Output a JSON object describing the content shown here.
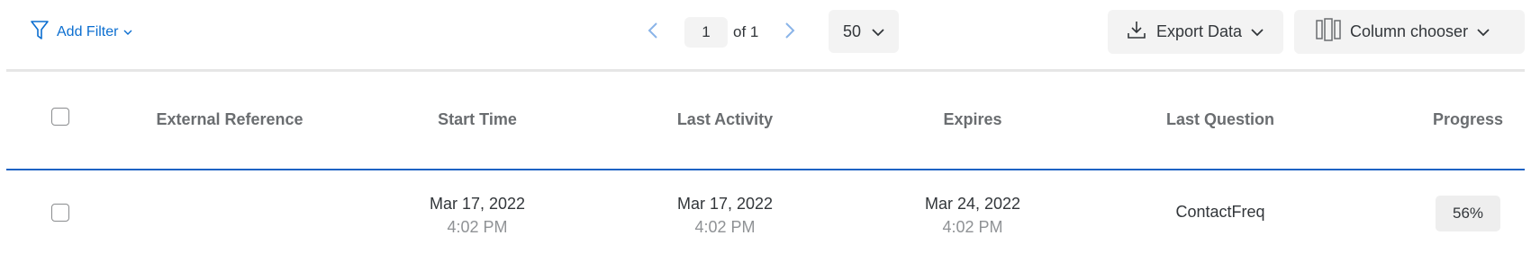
{
  "toolbar": {
    "add_filter_label": "Add Filter",
    "pagination": {
      "current_page": "1",
      "of_label": "of 1"
    },
    "per_page_value": "50",
    "export_label": "Export Data",
    "column_chooser_label": "Column chooser"
  },
  "table": {
    "columns": {
      "external_reference": "External Reference",
      "start_time": "Start Time",
      "last_activity": "Last Activity",
      "expires": "Expires",
      "last_question": "Last Question",
      "progress": "Progress"
    },
    "rows": [
      {
        "external_reference": "",
        "start_date": "Mar 17, 2022",
        "start_time": "4:02 PM",
        "last_activity_date": "Mar 17, 2022",
        "last_activity_time": "4:02 PM",
        "expires_date": "Mar 24, 2022",
        "expires_time": "4:02 PM",
        "last_question": "ContactFreq",
        "progress": "56%"
      }
    ]
  },
  "colors": {
    "accent_blue": "#0b6ed0",
    "row_divider_blue": "#1e63c4",
    "button_bg": "#f3f3f3"
  },
  "icons": {
    "filter": "funnel-icon",
    "prev": "chevron-left-icon",
    "next": "chevron-right-icon",
    "dropdown": "chevron-down-icon",
    "export": "download-icon",
    "columns": "columns-icon"
  }
}
